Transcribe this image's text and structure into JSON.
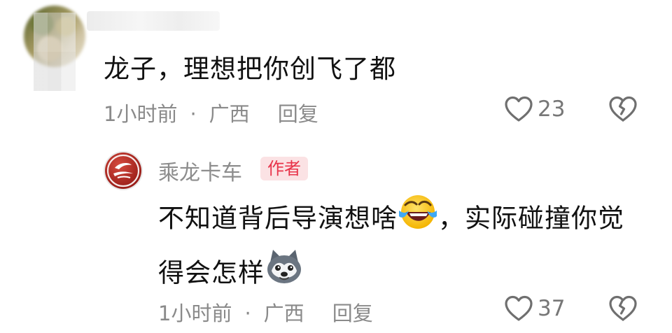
{
  "comment": {
    "text": "龙子，理想把你创飞了都",
    "time": "1小时前",
    "separator": "·",
    "location": "广西",
    "reply_label": "回复",
    "likes": "23",
    "icons": [
      "heart-icon",
      "broken-heart-icon"
    ]
  },
  "reply": {
    "author": "乘龙卡车",
    "badge": "作者",
    "text_part1": "不知道背后导演想啥",
    "text_part2": "，实际碰撞你觉",
    "text_part3": "得会怎样",
    "time": "1小时前",
    "separator": "·",
    "location": "广西",
    "reply_label": "回复",
    "likes": "37",
    "icons": [
      "laughing-tears-emoji",
      "husky-dog-emoji",
      "heart-icon",
      "broken-heart-icon"
    ]
  },
  "colors": {
    "text": "#111111",
    "meta": "#8a8a8a",
    "badge_bg": "#fbe2e4",
    "badge_text": "#e8334a",
    "avatar_red": "#b3241e"
  }
}
